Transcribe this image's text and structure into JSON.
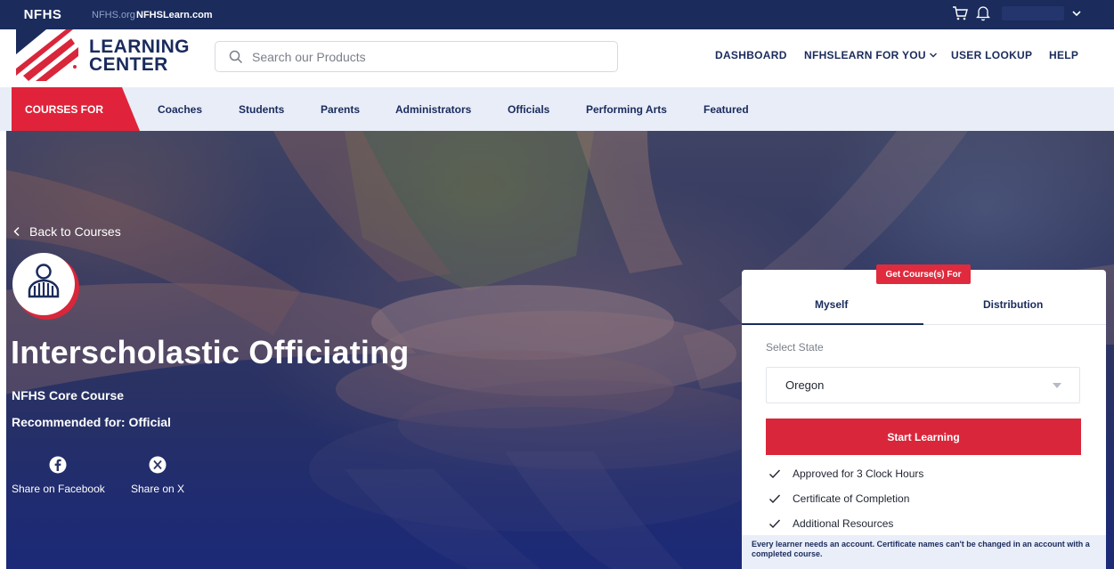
{
  "topbar": {
    "brand": "NFHS",
    "links": [
      "NFHS.org",
      "NFHSLearn.com"
    ],
    "icons": [
      "cart-icon",
      "bell-icon",
      "chevron-down-icon"
    ]
  },
  "header": {
    "logo_line1": "LEARNING",
    "logo_line2": "CENTER",
    "search_placeholder": "Search our Products",
    "nav": [
      "DASHBOARD",
      "NFHSLEARN FOR YOU",
      "USER LOOKUP",
      "HELP"
    ]
  },
  "categories": {
    "label": "COURSES FOR",
    "items": [
      "Coaches",
      "Students",
      "Parents",
      "Administrators",
      "Officials",
      "Performing Arts",
      "Featured"
    ]
  },
  "course": {
    "back_label": "Back to Courses",
    "title": "Interscholastic Officiating",
    "subtitle": "NFHS Core Course",
    "recommended": "Recommended for: Official",
    "share": [
      "Share on Facebook",
      "Share on X"
    ]
  },
  "purchase": {
    "tag": "Get Course(s) For",
    "tabs": [
      "Myself",
      "Distribution"
    ],
    "active_tab": "Myself",
    "state_label": "Select State",
    "state_value": "Oregon",
    "start_label": "Start Learning",
    "features": [
      "Approved for 3 Clock Hours",
      "Certificate of Completion",
      "Additional Resources"
    ],
    "notice": "Every learner needs an account. Certificate names can't be changed in an account with a completed course."
  },
  "colors": {
    "navy": "#1a2b5c",
    "red": "#d9263a",
    "light_blue": "#e8edf8"
  }
}
